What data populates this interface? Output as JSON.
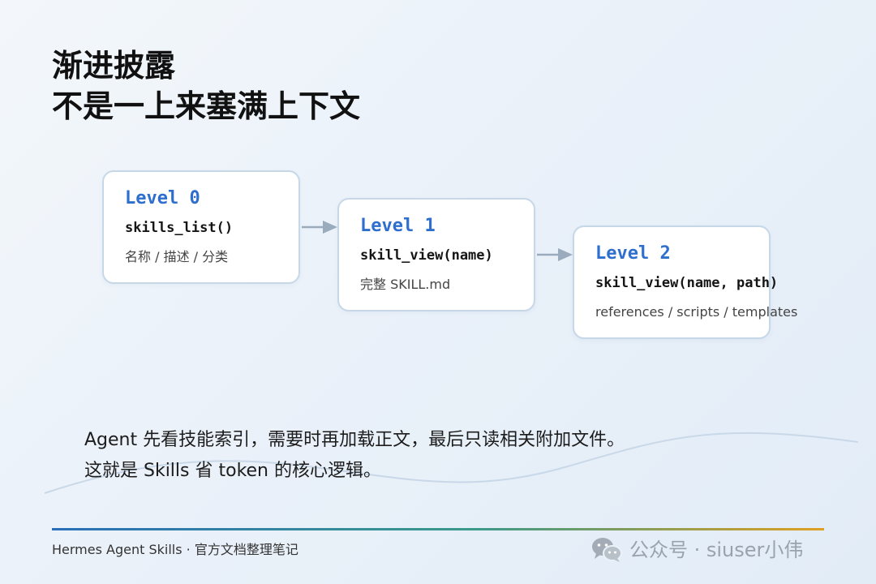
{
  "title": {
    "line1": "渐进披露",
    "line2": "不是一上来塞满上下文"
  },
  "levels": [
    {
      "level": "Level 0",
      "call": "skills_list()",
      "desc": "名称 / 描述 / 分类"
    },
    {
      "level": "Level 1",
      "call": "skill_view(name)",
      "desc": "完整 SKILL.md"
    },
    {
      "level": "Level 2",
      "call": "skill_view(name, path)",
      "desc": "references / scripts / templates"
    }
  ],
  "edges": [
    {
      "from": "Level 0",
      "to": "Level 1"
    },
    {
      "from": "Level 1",
      "to": "Level 2"
    }
  ],
  "summary": {
    "line1": "Agent 先看技能索引，需要时再加载正文，最后只读相关附加文件。",
    "line2": "这就是 Skills 省 token 的核心逻辑。"
  },
  "footer": {
    "left": "Hermes Agent Skills · 官方文档整理笔记",
    "watermark": "公众号 · siuser小伟",
    "watermark_icon": "wechat-icon"
  },
  "colors": {
    "accent": "#2e6fce",
    "card_border": "#c6d7e8",
    "arrow": "#9aabbd"
  }
}
